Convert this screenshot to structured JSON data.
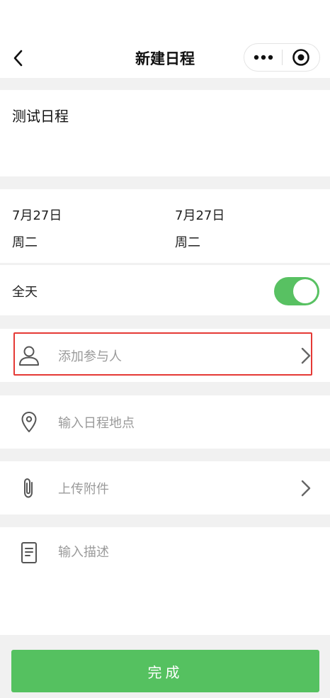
{
  "nav": {
    "title": "新建日程",
    "back_icon": "chevron-left-icon",
    "more_icon": "more-dots-icon",
    "close_icon": "target-circle-icon"
  },
  "event": {
    "title": "测试日程"
  },
  "dates": {
    "start": {
      "date": "7月27日",
      "weekday": "周二"
    },
    "end": {
      "date": "7月27日",
      "weekday": "周二"
    }
  },
  "allday": {
    "label": "全天",
    "on": true
  },
  "rows": {
    "attendee": {
      "placeholder": "添加参与人",
      "icon": "person-icon"
    },
    "location": {
      "placeholder": "输入日程地点",
      "icon": "location-pin-icon"
    },
    "attachment": {
      "placeholder": "上传附件",
      "icon": "paperclip-icon"
    },
    "description": {
      "placeholder": "输入描述",
      "icon": "document-icon"
    }
  },
  "actions": {
    "done_label": "完成"
  },
  "colors": {
    "accent": "#55c160",
    "highlight": "#e53935",
    "background": "#f1f1f1"
  }
}
